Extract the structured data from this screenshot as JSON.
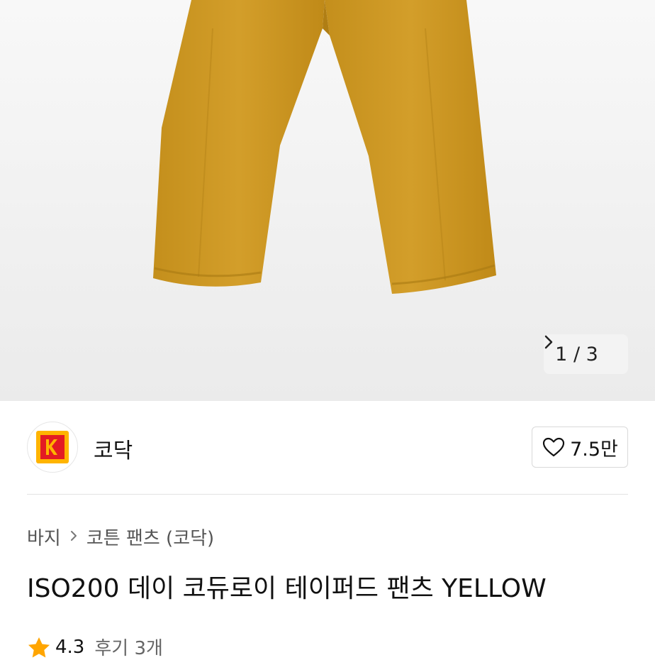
{
  "gallery": {
    "current_page": "1",
    "separator": "/",
    "total_pages": "3",
    "next_icon": "chevron-right-icon"
  },
  "brand": {
    "name": "코닥",
    "logo_letter": "K",
    "logo_color": "#e31b23",
    "logo_accent": "#ffb400"
  },
  "like": {
    "icon": "heart-icon",
    "count": "7.5만"
  },
  "breadcrumb": {
    "items": [
      "바지",
      "코튼 팬츠 (코닥)"
    ],
    "separator_icon": "chevron-right-icon"
  },
  "product": {
    "title": "ISO200 데이 코듀로이 테이퍼드 팬츠 YELLOW",
    "color": "#c9951f"
  },
  "rating": {
    "icon": "star-icon",
    "star_color": "#ffa500",
    "score": "4.3",
    "reviews": "후기 3개"
  }
}
